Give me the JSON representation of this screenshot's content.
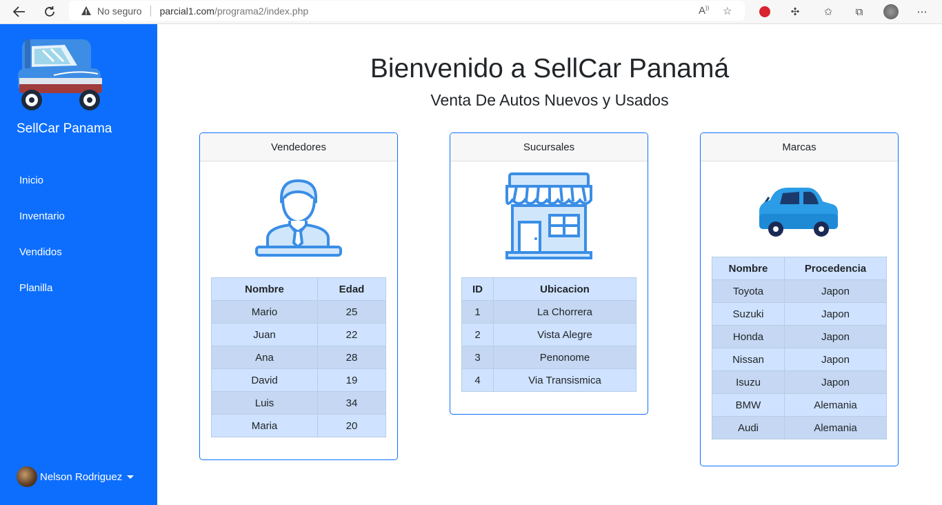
{
  "browser": {
    "security_label": "No seguro",
    "url_host": "parcial1.com",
    "url_path": "/programa2/index.php"
  },
  "sidebar": {
    "brand": "SellCar Panama",
    "items": [
      {
        "label": "Inicio"
      },
      {
        "label": "Inventario"
      },
      {
        "label": "Vendidos"
      },
      {
        "label": "Planilla"
      }
    ],
    "user_name": "Nelson Rodriguez"
  },
  "main": {
    "title": "Bienvenido a SellCar Panamá",
    "subtitle": "Venta De Autos Nuevos y Usados"
  },
  "cards": {
    "vendedores": {
      "header": "Vendedores",
      "columns": [
        "Nombre",
        "Edad"
      ],
      "rows": [
        [
          "Mario",
          "25"
        ],
        [
          "Juan",
          "22"
        ],
        [
          "Ana",
          "28"
        ],
        [
          "David",
          "19"
        ],
        [
          "Luis",
          "34"
        ],
        [
          "Maria",
          "20"
        ]
      ]
    },
    "sucursales": {
      "header": "Sucursales",
      "columns": [
        "ID",
        "Ubicacion"
      ],
      "rows": [
        [
          "1",
          "La Chorrera"
        ],
        [
          "2",
          "Vista Alegre"
        ],
        [
          "3",
          "Penonome"
        ],
        [
          "4",
          "Via Transismica"
        ]
      ]
    },
    "marcas": {
      "header": "Marcas",
      "columns": [
        "Nombre",
        "Procedencia"
      ],
      "rows": [
        [
          "Toyota",
          "Japon"
        ],
        [
          "Suzuki",
          "Japon"
        ],
        [
          "Honda",
          "Japon"
        ],
        [
          "Nissan",
          "Japon"
        ],
        [
          "Isuzu",
          "Japon"
        ],
        [
          "BMW",
          "Alemania"
        ],
        [
          "Audi",
          "Alemania"
        ]
      ]
    }
  },
  "colors": {
    "sidebar": "#0d6efd",
    "card_border": "#0d6efd",
    "table_header": "#cfe2ff"
  }
}
